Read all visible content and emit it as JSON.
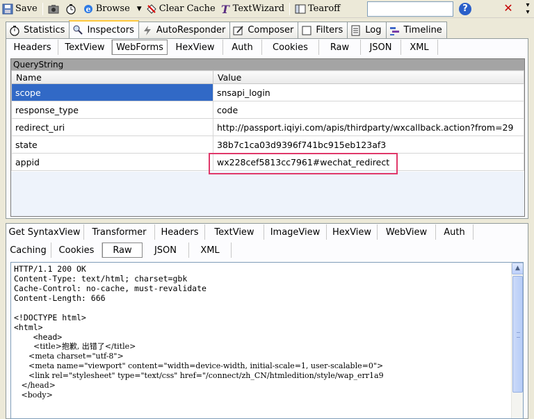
{
  "toolbar": {
    "save_label": "Save",
    "browse_label": "Browse",
    "clear_cache_label": "Clear Cache",
    "textwizard_label": "TextWizard",
    "tearoff_label": "Tearoff",
    "search_value": "",
    "help_label": "?",
    "close_label": "✕"
  },
  "main_tabs": [
    {
      "label": "Statistics"
    },
    {
      "label": "Inspectors"
    },
    {
      "label": "AutoResponder"
    },
    {
      "label": "Composer"
    },
    {
      "label": "Filters"
    },
    {
      "label": "Log"
    },
    {
      "label": "Timeline"
    }
  ],
  "request_tabs": [
    "Headers",
    "TextView",
    "WebForms",
    "HexView",
    "Auth",
    "Cookies",
    "Raw",
    "JSON",
    "XML"
  ],
  "querystring": {
    "caption": "QueryString",
    "col_name": "Name",
    "col_value": "Value",
    "rows": [
      {
        "name": "scope",
        "value": "snsapi_login"
      },
      {
        "name": "response_type",
        "value": "code"
      },
      {
        "name": "redirect_uri",
        "value": "http://passport.iqiyi.com/apis/thirdparty/wxcallback.action?from=29"
      },
      {
        "name": "state",
        "value": "38b7c1ca03d9396f741bc915eb123af3"
      },
      {
        "name": "appid",
        "value": "wx228cef5813cc7961#wechat_redirect"
      }
    ]
  },
  "response_tabs_row1": [
    "Get SyntaxView",
    "Transformer",
    "Headers",
    "TextView",
    "ImageView",
    "HexView",
    "WebView",
    "Auth"
  ],
  "response_tabs_row2": [
    "Caching",
    "Cookies",
    "Raw",
    "JSON",
    "XML"
  ],
  "raw_lines": [
    "HTTP/1.1 200 OK",
    "Content-Type: text/html; charset=gbk",
    "Cache-Control: no-cache, must-revalidate",
    "Content-Length: 666",
    "",
    "<!DOCTYPE html>",
    "<html>",
    "    <head>",
    "        <title>抱歉, 出错了</title>",
    "      <meta charset=\"utf-8\">",
    "      <meta name=\"viewport\" content=\"width=device-width, initial-scale=1, user-scalable=0\">",
    "      <link rel=\"stylesheet\" type=\"text/css\" href=\"/connect/zh_CN/htmledition/style/wap_err1a9",
    "   </head>",
    "   <body>"
  ],
  "colors": {
    "selection": "#3169c6",
    "highlight_box": "#e0386a",
    "active_tab_top": "#ffc83c"
  }
}
